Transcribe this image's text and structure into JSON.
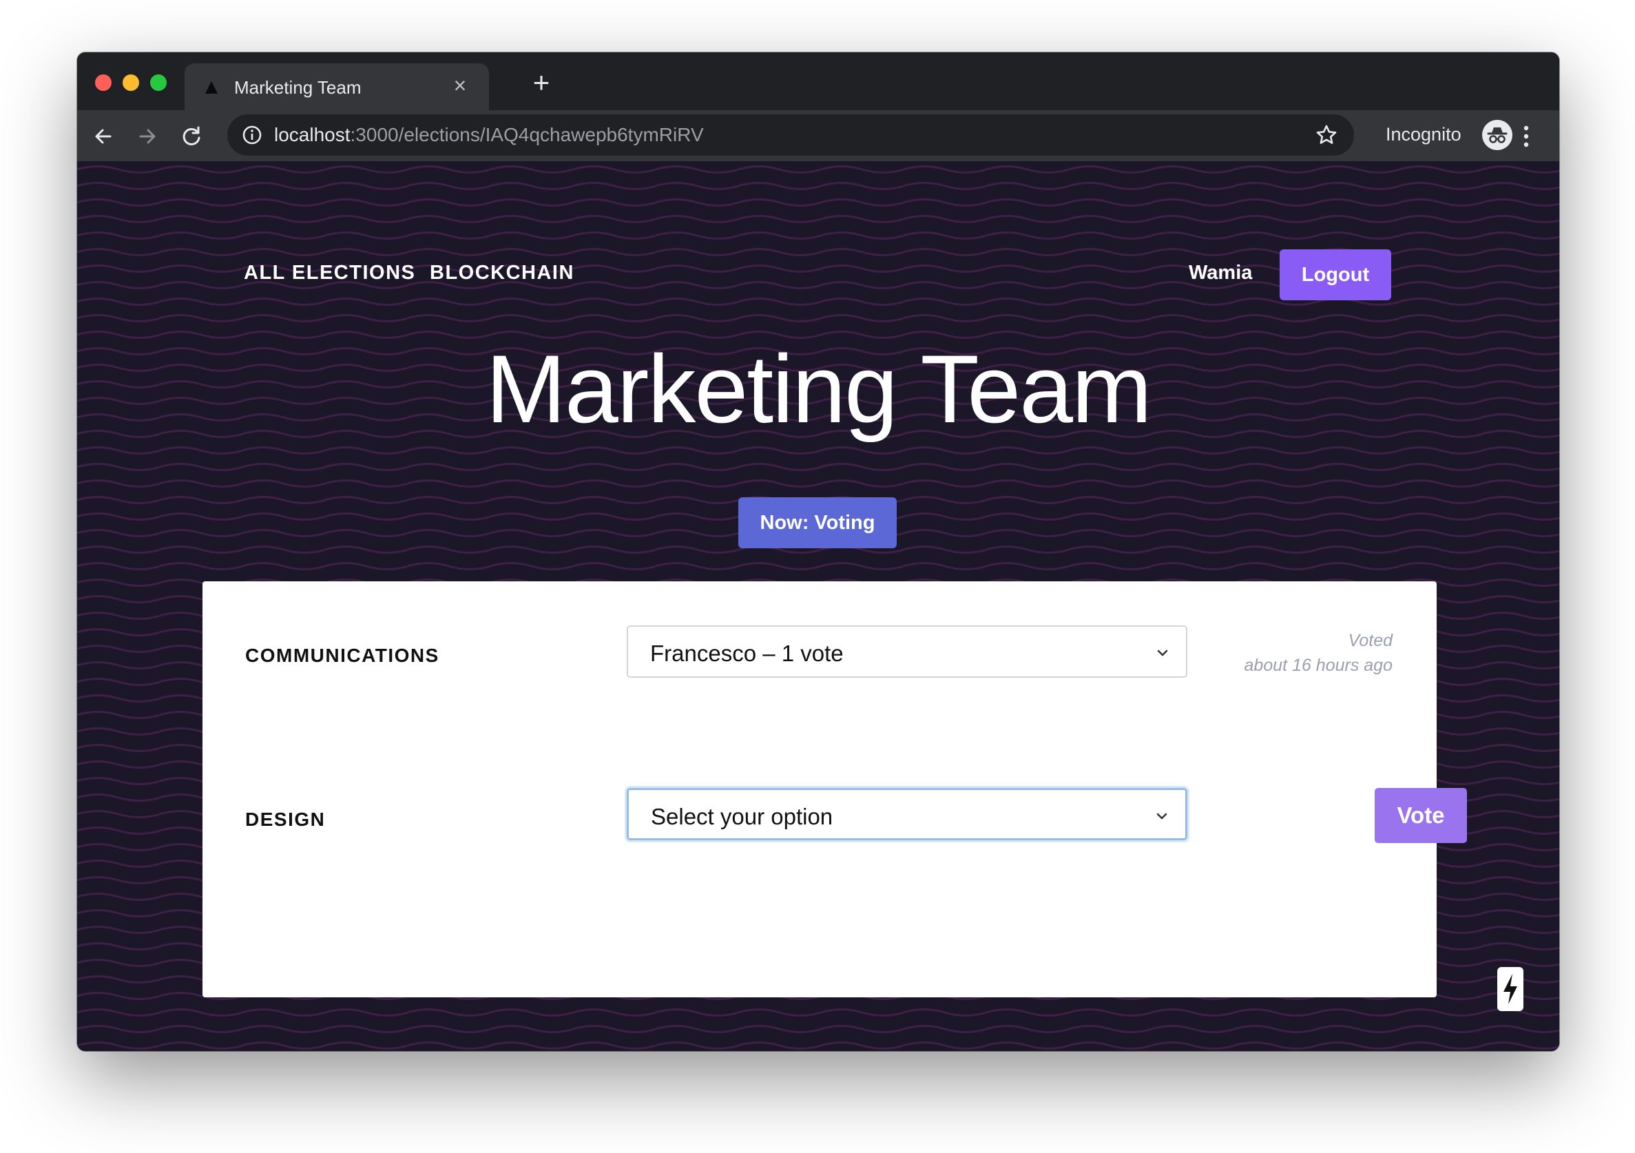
{
  "browser": {
    "tab_title": "Marketing Team",
    "url_host": "localhost",
    "url_path": ":3000/elections/IAQ4qchawepb6tymRiRV",
    "incognito_label": "Incognito"
  },
  "nav": {
    "links": [
      "ALL ELECTIONS",
      "BLOCKCHAIN"
    ],
    "user_name": "Wamia",
    "logout_label": "Logout"
  },
  "election": {
    "title": "Marketing Team",
    "status_label": "Now: Voting"
  },
  "offices": [
    {
      "name": "COMMUNICATIONS",
      "selected": "Francesco – 1 vote",
      "voted_label": "Voted",
      "voted_time": "about 16 hours ago"
    },
    {
      "name": "DESIGN",
      "selected": "Select your option",
      "vote_label": "Vote"
    }
  ],
  "colors": {
    "background": "#1b1729",
    "accent_purple": "#8a5cf6",
    "status_blue": "#5b68d6",
    "vote_purple": "#9a74ef"
  }
}
